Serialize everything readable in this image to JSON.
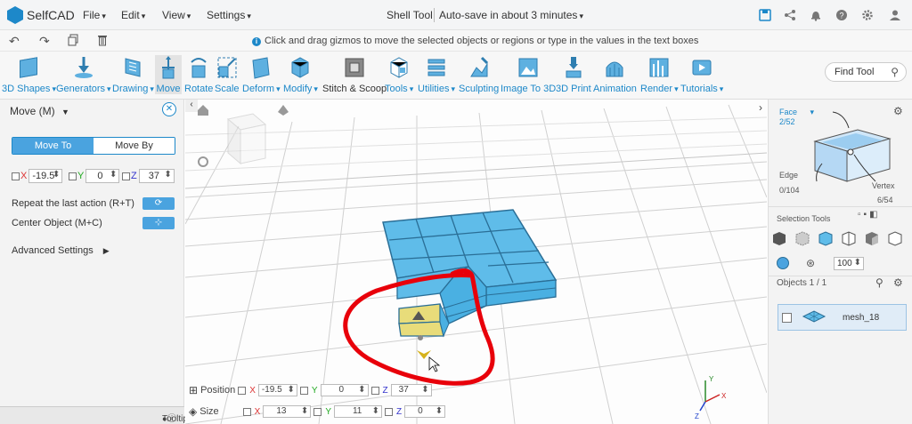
{
  "app": {
    "name": "SelfCAD",
    "doc_title": "Shell Tool",
    "autosave": "Auto-save in about 3 minutes"
  },
  "menu": {
    "file": "File",
    "edit": "Edit",
    "view": "View",
    "settings": "Settings"
  },
  "hint": "Click and drag gizmos to move the selected objects or regions or type in the values in the text boxes",
  "toolbar": [
    {
      "label": "3D Shapes",
      "icon": "cube-icon"
    },
    {
      "label": "Generators",
      "icon": "generator-icon"
    },
    {
      "label": "Drawing",
      "icon": "drawing-icon"
    },
    {
      "label": "Move",
      "icon": "move-icon"
    },
    {
      "label": "Rotate",
      "icon": "rotate-icon"
    },
    {
      "label": "Scale",
      "icon": "scale-icon"
    },
    {
      "label": "Deform",
      "icon": "deform-icon"
    },
    {
      "label": "Modify",
      "icon": "modify-icon"
    },
    {
      "label": "Stitch & Scoop",
      "icon": "stitch-icon"
    },
    {
      "label": "Tools",
      "icon": "tools-icon"
    },
    {
      "label": "Utilities",
      "icon": "utilities-icon"
    },
    {
      "label": "Sculpting",
      "icon": "sculpting-icon"
    },
    {
      "label": "Image To 3D",
      "icon": "image-icon"
    },
    {
      "label": "3D Print",
      "icon": "printer-icon"
    },
    {
      "label": "Animation",
      "icon": "animation-icon"
    },
    {
      "label": "Render",
      "icon": "render-icon"
    },
    {
      "label": "Tutorials",
      "icon": "tutorials-icon"
    }
  ],
  "find_tool": "Find Tool",
  "left_panel": {
    "title": "Move (M)",
    "mode_move_to": "Move To",
    "mode_move_by": "Move By",
    "x_label": "X",
    "x_value": "-19.5",
    "y_label": "Y",
    "y_value": "0",
    "z_label": "Z",
    "z_value": "37",
    "repeat_label": "Repeat the last action (R+T)",
    "center_label": "Center Object (M+C)",
    "advanced": "Advanced Settings",
    "tooltip": "Tooltip"
  },
  "viewport": {
    "position_label": "Position",
    "pos_x": "-19.5",
    "pos_y": "0",
    "pos_z": "37",
    "size_label": "Size",
    "size_x": "13",
    "size_y": "11",
    "size_z": "0",
    "x": "X",
    "y": "Y",
    "z": "Z"
  },
  "right_panel": {
    "face_label": "Face",
    "face_count": "2/52",
    "edge_label": "Edge",
    "edge_count": "0/104",
    "vertex_label": "Vertex",
    "vertex_count": "6/54",
    "selection_tools": "Selection Tools",
    "percent": "100",
    "objects_label": "Objects 1 / 1",
    "object_name": "mesh_18"
  },
  "colors": {
    "accent": "#1d88c9",
    "mesh": "#5fbce9",
    "selected_face": "#e8dc7a",
    "annotation": "#e8000a"
  }
}
